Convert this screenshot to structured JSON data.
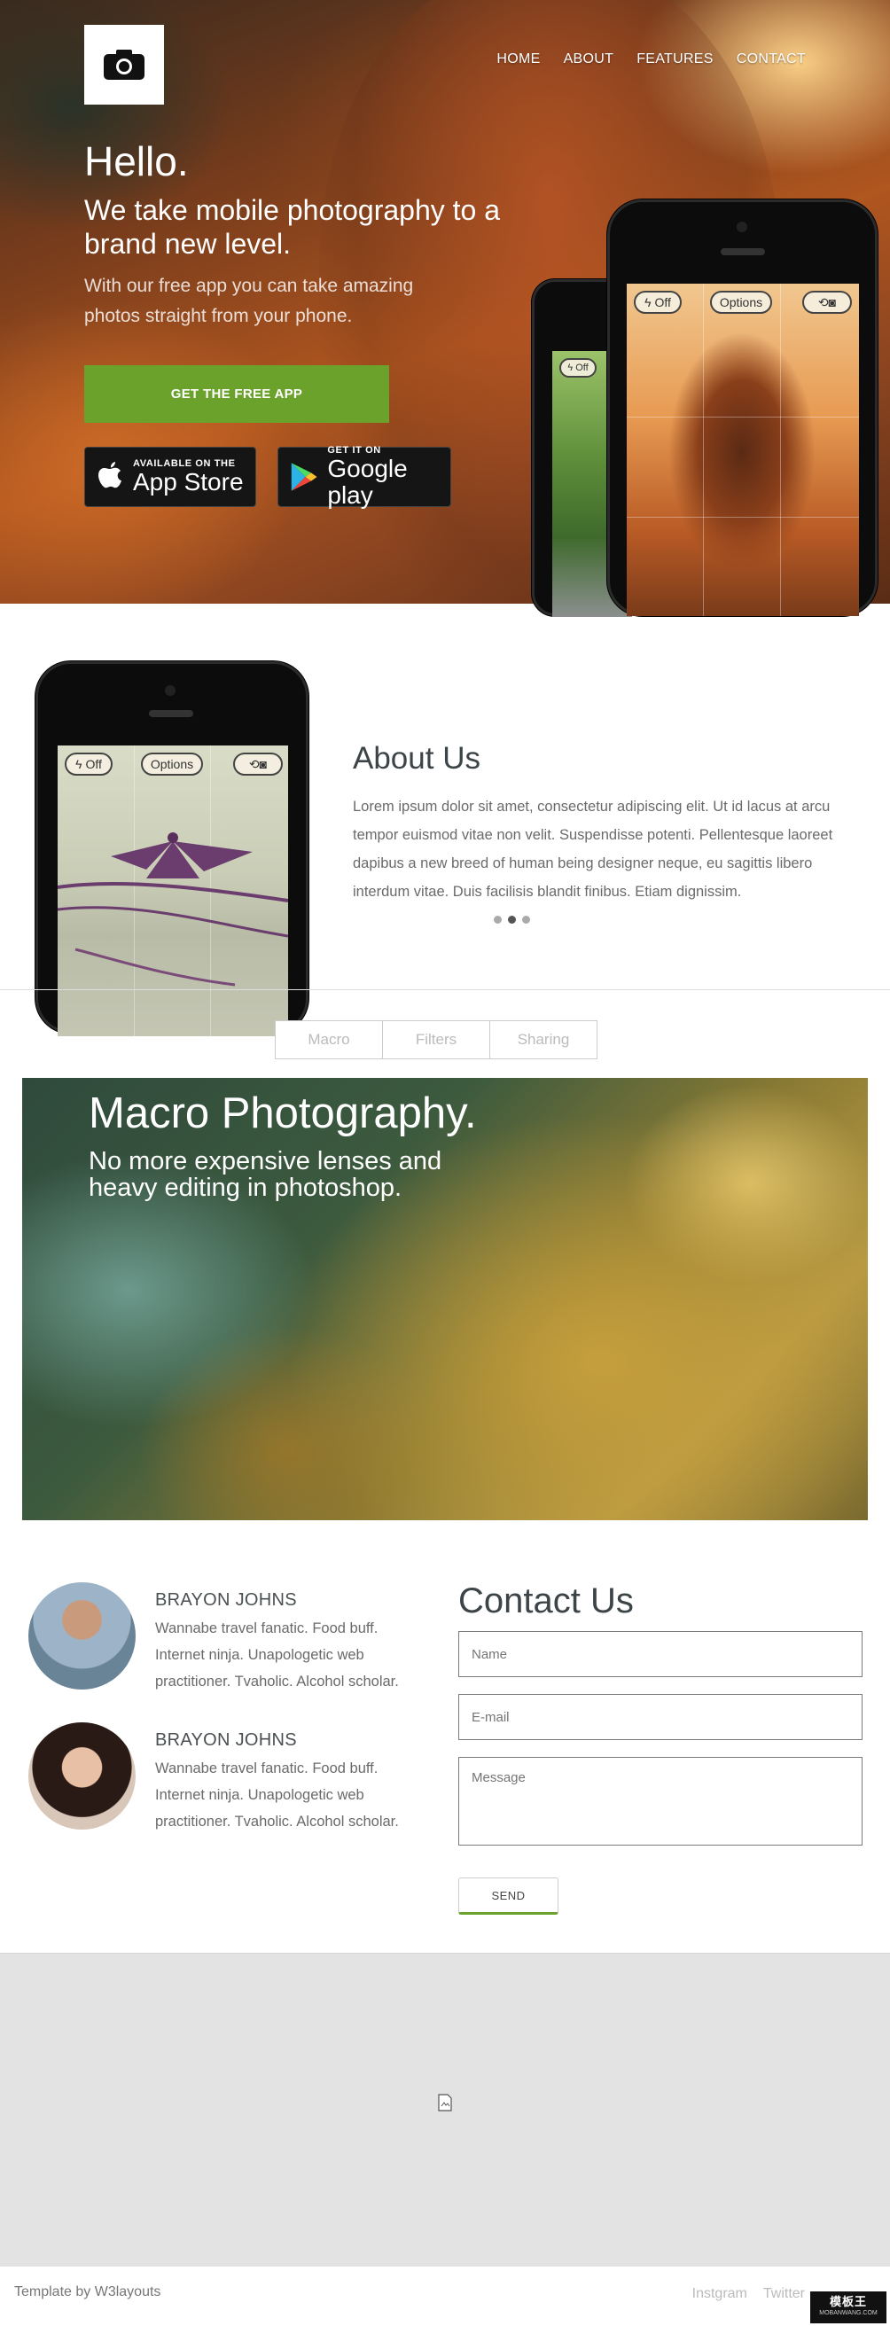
{
  "header": {
    "nav": [
      "HOME",
      "ABOUT",
      "FEATURES",
      "CONTACT"
    ],
    "camera_icon": "camera-icon"
  },
  "hero": {
    "hello": "Hello.",
    "tagline": "We take mobile photography to a brand new level.",
    "subtext": "With our free app you can take amazing photos straight from your phone.",
    "cta_label": "GET THE FREE APP",
    "app_store_small": "AVAILABLE ON THE",
    "app_store_big": "App Store",
    "google_small": "GET IT ON",
    "google_big": "Google play"
  },
  "camera_ui": {
    "flash": "Off",
    "options": "Options"
  },
  "about": {
    "title": "About Us",
    "text": "Lorem ipsum dolor sit amet, consectetur adipiscing elit. Ut id lacus at arcu tempor euismod vitae non velit. Suspendisse potenti. Pellentesque laoreet dapibus a new breed of human being designer neque, eu sagittis libero interdum vitae. Duis facilisis blandit finibus. Etiam dignissim.",
    "active_dot": 2
  },
  "tabs": [
    "Macro",
    "Filters",
    "Sharing"
  ],
  "feature": {
    "title": "Macro Photography.",
    "subtitle": "No more expensive lenses and heavy editing in photoshop."
  },
  "team": [
    {
      "name": "BRAYON JOHNS",
      "bio": "Wannabe travel fanatic. Food buff. Internet ninja. Unapologetic web practitioner. Tvaholic. Alcohol scholar."
    },
    {
      "name": "BRAYON JOHNS",
      "bio": "Wannabe travel fanatic. Food buff. Internet ninja. Unapologetic web practitioner. Tvaholic. Alcohol scholar."
    }
  ],
  "contact": {
    "title": "Contact Us",
    "name_placeholder": "Name",
    "email_placeholder": "E-mail",
    "message_placeholder": "Message",
    "send_label": "SEND"
  },
  "footer": {
    "credit": "Template by W3layouts",
    "social": [
      "Instgram",
      "Twitter"
    ],
    "badge_main": "模板王",
    "badge_sub": "MOBANWANG.COM"
  },
  "colors": {
    "accent": "#6aa22c",
    "heading": "#3d4448"
  }
}
